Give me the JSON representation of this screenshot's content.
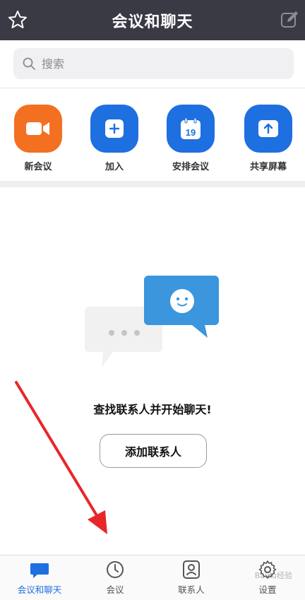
{
  "header": {
    "title": "会议和聊天"
  },
  "search": {
    "placeholder": "搜索"
  },
  "actions": [
    {
      "label": "新会议",
      "color": "#f37021",
      "icon": "video-camera-icon"
    },
    {
      "label": "加入",
      "color": "#1e6fe0",
      "icon": "plus-icon"
    },
    {
      "label": "安排会议",
      "color": "#1e6fe0",
      "icon": "calendar-icon",
      "icon_text": "19"
    },
    {
      "label": "共享屏幕",
      "color": "#1e6fe0",
      "icon": "share-screen-icon"
    }
  ],
  "empty_state": {
    "message": "查找联系人并开始聊天!",
    "button_label": "添加联系人"
  },
  "tabs": [
    {
      "label": "会议和聊天",
      "icon": "chat-bubble-icon",
      "active": true
    },
    {
      "label": "会议",
      "icon": "clock-icon",
      "active": false
    },
    {
      "label": "联系人",
      "icon": "contact-icon",
      "active": false
    },
    {
      "label": "设置",
      "icon": "gear-icon",
      "active": false
    }
  ],
  "watermark": {
    "text": "Baidu经验"
  },
  "colors": {
    "header_bg": "#3a3a45",
    "accent_blue": "#1e6fe0",
    "accent_orange": "#f37021",
    "arrow_red": "#e8262a"
  }
}
